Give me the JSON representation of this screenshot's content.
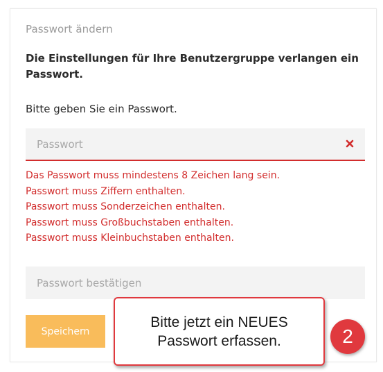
{
  "dialog": {
    "title": "Passwort ändern",
    "notice": "Die Einstellungen für Ihre Benutzergruppe verlangen ein Passwort.",
    "instruction": "Bitte geben Sie ein Passwort.",
    "password_field": {
      "placeholder": "Passwort",
      "value": ""
    },
    "errors": [
      "Das Passwort muss mindestens 8 Zeichen lang sein.",
      "Passwort muss Ziffern enthalten.",
      "Passwort muss Sonderzeichen enthalten.",
      "Passwort muss Großbuchstaben enthalten.",
      "Passwort muss Kleinbuchstaben enthalten."
    ],
    "confirm_field": {
      "placeholder": "Passwort bestätigen",
      "value": ""
    },
    "save_label": "Speichern"
  },
  "annotation": {
    "callout_text": "Bitte jetzt ein NEUES Passwort erfassen.",
    "step_number": "2"
  },
  "colors": {
    "error": "#d22d2d",
    "button": "#f9bc5b",
    "field_bg": "#f3f3f3",
    "callout_accent": "#e0393e"
  },
  "icons": {
    "clear": "close-icon"
  }
}
